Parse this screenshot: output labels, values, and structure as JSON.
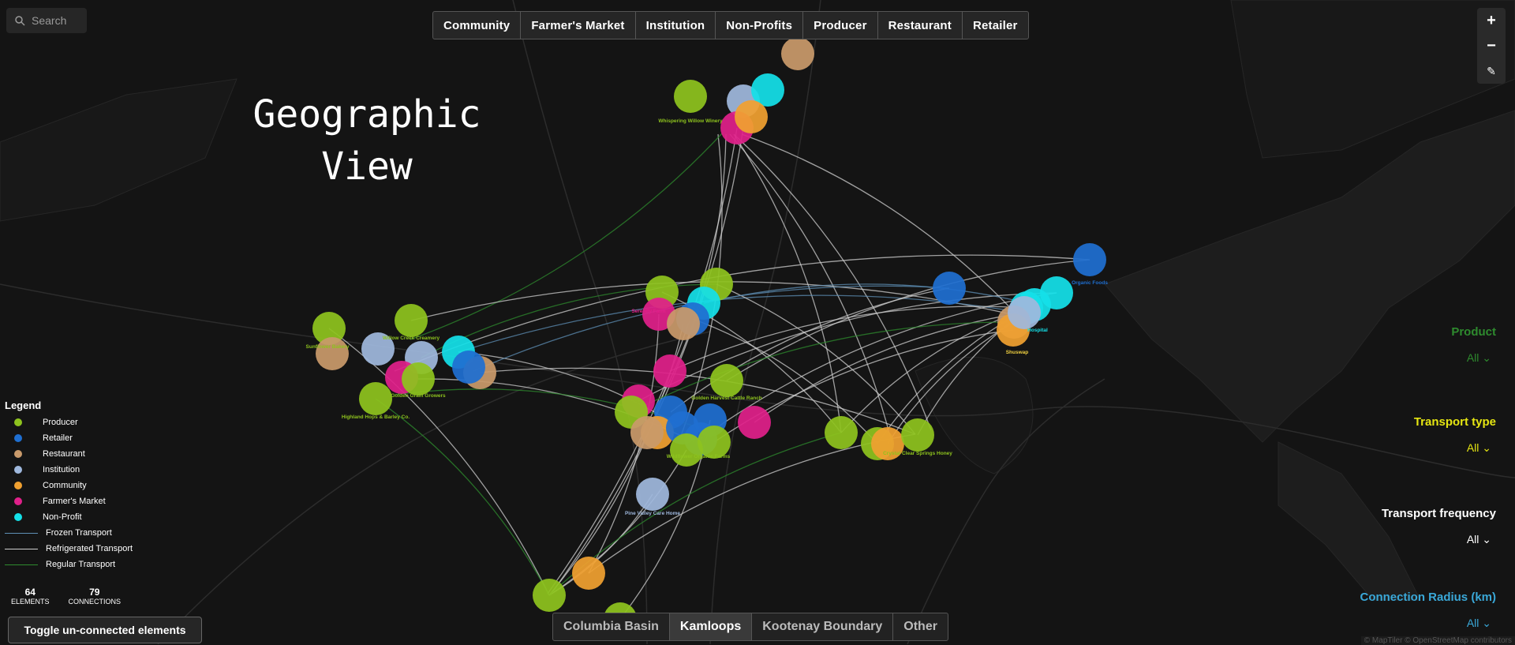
{
  "search": {
    "placeholder": "Search"
  },
  "category_tabs": [
    "Community",
    "Farmer's Market",
    "Institution",
    "Non-Profits",
    "Producer",
    "Restaurant",
    "Retailer"
  ],
  "view_title": "Geographic\nView",
  "zoom": {
    "in": "+",
    "out": "−",
    "edit": "✎"
  },
  "legend": {
    "title": "Legend",
    "nodes": [
      {
        "label": "Producer",
        "color": "#8ec31e"
      },
      {
        "label": "Retailer",
        "color": "#1f6fd1"
      },
      {
        "label": "Restaurant",
        "color": "#c99a6b"
      },
      {
        "label": "Institution",
        "color": "#9fb8dd"
      },
      {
        "label": "Community",
        "color": "#f0a030"
      },
      {
        "label": "Farmer's Market",
        "color": "#e0208a"
      },
      {
        "label": "Non-Profit",
        "color": "#14e0e8"
      }
    ],
    "links": [
      {
        "label": "Frozen Transport",
        "color": "#5e8fb5"
      },
      {
        "label": "Refrigerated Transport",
        "color": "#d0d0d0"
      },
      {
        "label": "Regular Transport",
        "color": "#2e8b2e"
      }
    ]
  },
  "stats": {
    "elements": "64",
    "elements_label": "ELEMENTS",
    "connections": "79",
    "connections_label": "CONNECTIONS"
  },
  "toggle_button": "Toggle un-connected elements",
  "regions": {
    "tabs": [
      "Columbia Basin",
      "Kamloops",
      "Kootenay Boundary",
      "Other"
    ],
    "active": "Kamloops"
  },
  "filters": [
    {
      "label": "Product",
      "value": "All ⌄",
      "color": "#2e8b2e"
    },
    {
      "label": "Transport type",
      "value": "All ⌄",
      "color": "#e5e512"
    },
    {
      "label": "Transport frequency",
      "value": "All ⌄",
      "color": "#ffffff"
    },
    {
      "label": "Connection Radius (km)",
      "value": "All ⌄",
      "color": "#3aa8d8"
    }
  ],
  "attribution": "© MapTiler © OpenStreetMap contributors",
  "map_labels": [
    "Whispering Willow Winery",
    "Sunflower Bakery",
    "Willow Creek Creamery",
    "Golden Grain Growers",
    "Highland Hops & Barley Co.",
    "Serenity Farm",
    "Golden Harvest Cattle Ranch",
    "Wildflower Organic Farms",
    "Pine Valley Care Home",
    "Crystal Clear Springs Honey",
    "Shuswap",
    "Hospital",
    "Organic Foods"
  ]
}
